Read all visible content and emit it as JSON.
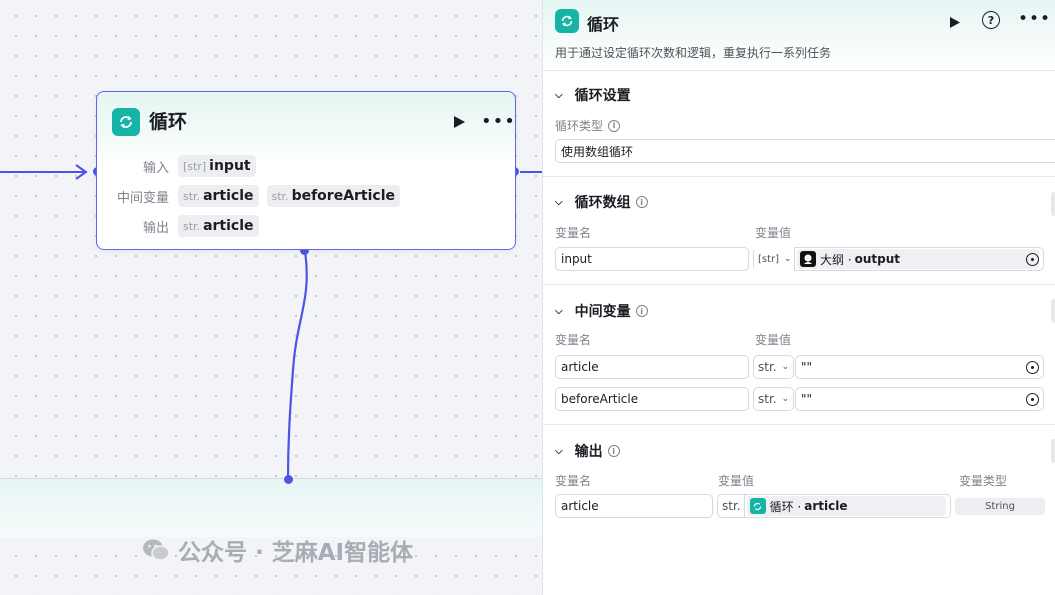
{
  "node": {
    "title": "循环",
    "rows": [
      {
        "label": "输入",
        "tags": [
          {
            "type": "[str]",
            "name": "input"
          }
        ]
      },
      {
        "label": "中间变量",
        "tags": [
          {
            "type": "str.",
            "name": "article"
          },
          {
            "type": "str.",
            "name": "beforeArticle"
          }
        ]
      },
      {
        "label": "输出",
        "tags": [
          {
            "type": "str.",
            "name": "article"
          }
        ]
      }
    ]
  },
  "panel": {
    "title": "循环",
    "description": "用于通过设定循环次数和逻辑，重复执行一系列任务",
    "loop_settings": {
      "title": "循环设置",
      "type_label": "循环类型",
      "type_value": "使用数组循环"
    },
    "loop_array": {
      "title": "循环数组",
      "col_name": "变量名",
      "col_value": "变量值",
      "rows": [
        {
          "name": "input",
          "type": "[str]",
          "ref_source": "大纲 ·",
          "ref_name": "output"
        }
      ]
    },
    "intermediate": {
      "title": "中间变量",
      "col_name": "变量名",
      "col_value": "变量值",
      "rows": [
        {
          "name": "article",
          "type": "str.",
          "value": "\"\""
        },
        {
          "name": "beforeArticle",
          "type": "str.",
          "value": "\"\""
        }
      ]
    },
    "output": {
      "title": "输出",
      "col_name": "变量名",
      "col_value": "变量值",
      "col_type": "变量类型",
      "rows": [
        {
          "name": "article",
          "type": "str.",
          "ref_source": "循环 ·",
          "ref_name": "article",
          "var_type": "String"
        }
      ]
    }
  },
  "watermark": "公众号 · 芝麻AI智能体",
  "colors": {
    "accent": "#4d53e8",
    "brand_teal": "#18b3a7"
  }
}
